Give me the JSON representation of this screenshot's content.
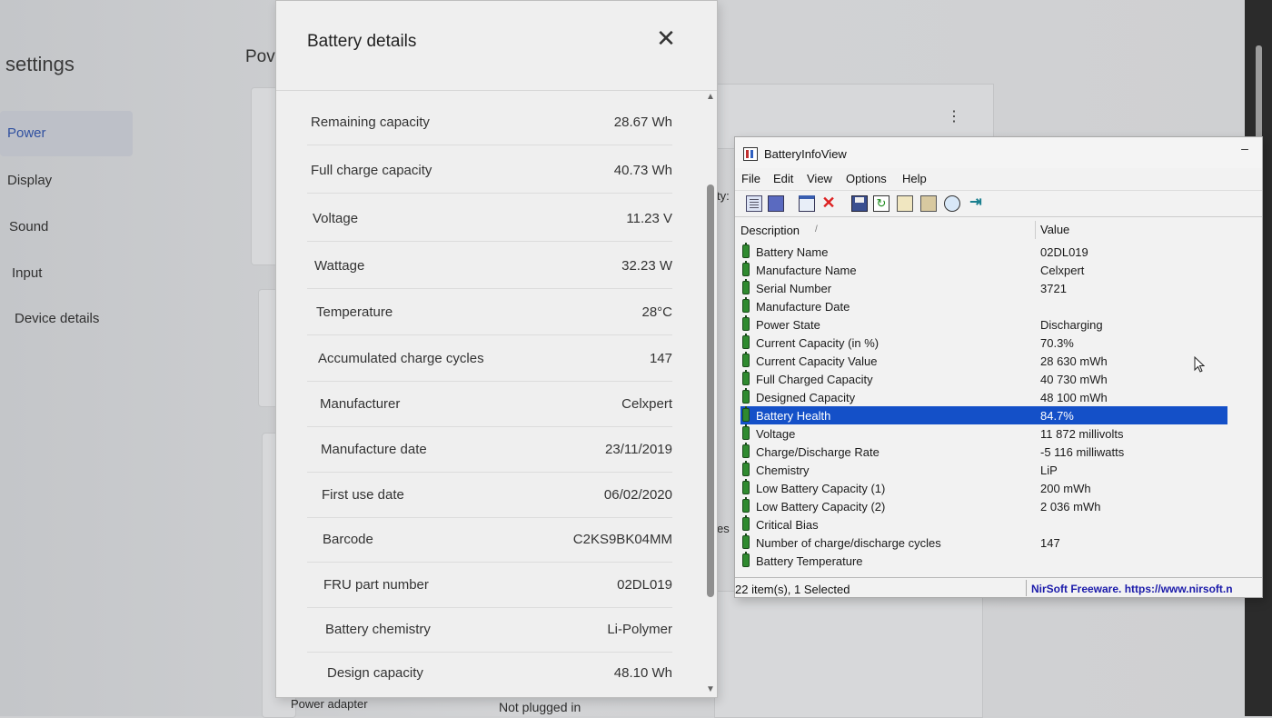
{
  "settings": {
    "title": "settings",
    "page_title": "Pov",
    "nav": [
      "Power",
      "Display",
      "Sound",
      "Input",
      "Device details"
    ],
    "fragments": {
      "ty": "ty:",
      "es": "es"
    },
    "power_adapter_label": "Power adapter",
    "power_adapter_value": "Not plugged in"
  },
  "battery_details": {
    "title": "Battery details",
    "rows": [
      {
        "label": "Remaining capacity",
        "value": "28.67 Wh"
      },
      {
        "label": "Full charge capacity",
        "value": "40.73 Wh"
      },
      {
        "label": "Voltage",
        "value": "11.23 V"
      },
      {
        "label": "Wattage",
        "value": "32.23 W"
      },
      {
        "label": "Temperature",
        "value": "28°C"
      },
      {
        "label": "Accumulated charge cycles",
        "value": "147"
      },
      {
        "label": "Manufacturer",
        "value": "Celxpert"
      },
      {
        "label": "Manufacture date",
        "value": "23/11/2019"
      },
      {
        "label": "First use date",
        "value": "06/02/2020"
      },
      {
        "label": "Barcode",
        "value": "C2KS9BK04MM"
      },
      {
        "label": "FRU part number",
        "value": "02DL019"
      },
      {
        "label": "Battery chemistry",
        "value": "Li-Polymer"
      },
      {
        "label": "Design capacity",
        "value": "48.10 Wh"
      }
    ]
  },
  "batteryinfoview": {
    "title": "BatteryInfoView",
    "menu": [
      "File",
      "Edit",
      "View",
      "Options",
      "Help"
    ],
    "columns": {
      "description": "Description",
      "value": "Value"
    },
    "items": [
      {
        "desc": "Battery Name",
        "value": "02DL019"
      },
      {
        "desc": "Manufacture Name",
        "value": "Celxpert"
      },
      {
        "desc": "Serial Number",
        "value": "3721"
      },
      {
        "desc": "Manufacture Date",
        "value": ""
      },
      {
        "desc": "Power State",
        "value": "Discharging"
      },
      {
        "desc": "Current Capacity (in %)",
        "value": "70.3%"
      },
      {
        "desc": "Current Capacity Value",
        "value": "28 630 mWh"
      },
      {
        "desc": "Full Charged Capacity",
        "value": "40 730 mWh"
      },
      {
        "desc": "Designed Capacity",
        "value": "48 100 mWh"
      },
      {
        "desc": "Battery Health",
        "value": "84.7%"
      },
      {
        "desc": "Voltage",
        "value": "11 872 millivolts"
      },
      {
        "desc": "Charge/Discharge Rate",
        "value": "-5 116 milliwatts"
      },
      {
        "desc": "Chemistry",
        "value": "LiP"
      },
      {
        "desc": "Low Battery Capacity (1)",
        "value": "200 mWh"
      },
      {
        "desc": "Low Battery Capacity (2)",
        "value": "2 036 mWh"
      },
      {
        "desc": "Critical Bias",
        "value": ""
      },
      {
        "desc": "Number of charge/discharge cycles",
        "value": "147"
      },
      {
        "desc": "Battery Temperature",
        "value": ""
      }
    ],
    "selected_item": "Battery Health",
    "status_left": "22 item(s), 1 Selected",
    "status_right": "NirSoft Freeware. https://www.nirsoft.n"
  }
}
